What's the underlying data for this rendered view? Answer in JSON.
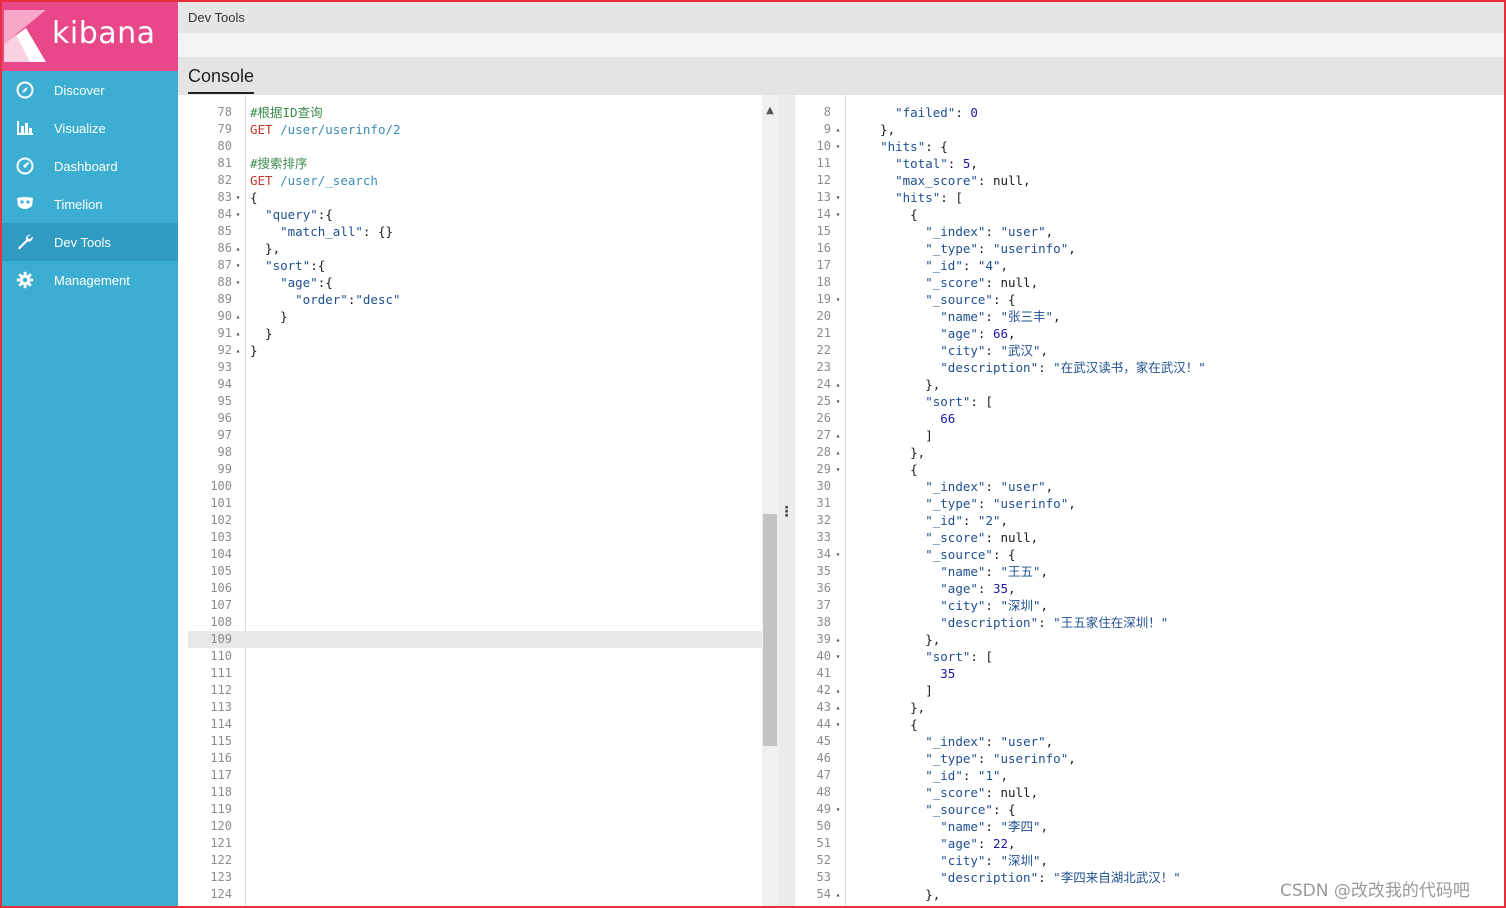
{
  "brand": {
    "name": "kibana",
    "logo_color": "#e8488a",
    "sidebar_color": "#3caed2"
  },
  "nav": [
    {
      "label": "Discover",
      "icon": "compass-icon"
    },
    {
      "label": "Visualize",
      "icon": "bar-chart-icon"
    },
    {
      "label": "Dashboard",
      "icon": "gauge-icon"
    },
    {
      "label": "Timelion",
      "icon": "mask-icon"
    },
    {
      "label": "Dev Tools",
      "icon": "wrench-icon",
      "active": true
    },
    {
      "label": "Management",
      "icon": "gear-icon"
    }
  ],
  "header": {
    "title": "Dev Tools"
  },
  "tabs": {
    "console": "Console"
  },
  "request_lines": [
    {
      "n": "78",
      "fold": "",
      "parts": [
        [
          "c-comment",
          "#根据ID查询"
        ]
      ]
    },
    {
      "n": "79",
      "fold": "",
      "parts": [
        [
          "c-method",
          "GET"
        ],
        [
          "c-plain",
          " "
        ],
        [
          "c-url",
          "/user/userinfo/2"
        ]
      ]
    },
    {
      "n": "80",
      "fold": "",
      "parts": []
    },
    {
      "n": "81",
      "fold": "",
      "parts": [
        [
          "c-comment",
          "#搜索排序"
        ]
      ]
    },
    {
      "n": "82",
      "fold": "",
      "parts": [
        [
          "c-method",
          "GET"
        ],
        [
          "c-plain",
          " "
        ],
        [
          "c-url",
          "/user/_search"
        ]
      ]
    },
    {
      "n": "83",
      "fold": "▾",
      "parts": [
        [
          "c-plain",
          "{"
        ]
      ]
    },
    {
      "n": "84",
      "fold": "▾",
      "parts": [
        [
          "c-plain",
          "  "
        ],
        [
          "c-key",
          "\"query\""
        ],
        [
          "c-plain",
          ":{"
        ]
      ]
    },
    {
      "n": "85",
      "fold": "",
      "parts": [
        [
          "c-plain",
          "    "
        ],
        [
          "c-key",
          "\"match_all\""
        ],
        [
          "c-plain",
          ": {}"
        ]
      ]
    },
    {
      "n": "86",
      "fold": "▴",
      "parts": [
        [
          "c-plain",
          "  },"
        ]
      ]
    },
    {
      "n": "87",
      "fold": "▾",
      "parts": [
        [
          "c-plain",
          "  "
        ],
        [
          "c-key",
          "\"sort\""
        ],
        [
          "c-plain",
          ":{"
        ]
      ]
    },
    {
      "n": "88",
      "fold": "▾",
      "parts": [
        [
          "c-plain",
          "    "
        ],
        [
          "c-key",
          "\"age\""
        ],
        [
          "c-plain",
          ":{"
        ]
      ]
    },
    {
      "n": "89",
      "fold": "",
      "parts": [
        [
          "c-plain",
          "      "
        ],
        [
          "c-key",
          "\"order\""
        ],
        [
          "c-plain",
          ":"
        ],
        [
          "c-str",
          "\"desc\""
        ]
      ]
    },
    {
      "n": "90",
      "fold": "▴",
      "parts": [
        [
          "c-plain",
          "    }"
        ]
      ]
    },
    {
      "n": "91",
      "fold": "▴",
      "parts": [
        [
          "c-plain",
          "  }"
        ]
      ]
    },
    {
      "n": "92",
      "fold": "▴",
      "parts": [
        [
          "c-plain",
          "}"
        ]
      ]
    },
    {
      "n": "93",
      "fold": "",
      "parts": []
    },
    {
      "n": "94",
      "fold": "",
      "parts": []
    },
    {
      "n": "95",
      "fold": "",
      "parts": []
    },
    {
      "n": "96",
      "fold": "",
      "parts": []
    },
    {
      "n": "97",
      "fold": "",
      "parts": []
    },
    {
      "n": "98",
      "fold": "",
      "parts": []
    },
    {
      "n": "99",
      "fold": "",
      "parts": []
    },
    {
      "n": "100",
      "fold": "",
      "parts": []
    },
    {
      "n": "101",
      "fold": "",
      "parts": []
    },
    {
      "n": "102",
      "fold": "",
      "parts": []
    },
    {
      "n": "103",
      "fold": "",
      "parts": []
    },
    {
      "n": "104",
      "fold": "",
      "parts": []
    },
    {
      "n": "105",
      "fold": "",
      "parts": []
    },
    {
      "n": "106",
      "fold": "",
      "parts": []
    },
    {
      "n": "107",
      "fold": "",
      "parts": []
    },
    {
      "n": "108",
      "fold": "",
      "parts": []
    },
    {
      "n": "109",
      "fold": "",
      "parts": [],
      "active": true
    },
    {
      "n": "110",
      "fold": "",
      "parts": []
    },
    {
      "n": "111",
      "fold": "",
      "parts": []
    },
    {
      "n": "112",
      "fold": "",
      "parts": []
    },
    {
      "n": "113",
      "fold": "",
      "parts": []
    },
    {
      "n": "114",
      "fold": "",
      "parts": []
    },
    {
      "n": "115",
      "fold": "",
      "parts": []
    },
    {
      "n": "116",
      "fold": "",
      "parts": []
    },
    {
      "n": "117",
      "fold": "",
      "parts": []
    },
    {
      "n": "118",
      "fold": "",
      "parts": []
    },
    {
      "n": "119",
      "fold": "",
      "parts": []
    },
    {
      "n": "120",
      "fold": "",
      "parts": []
    },
    {
      "n": "121",
      "fold": "",
      "parts": []
    },
    {
      "n": "122",
      "fold": "",
      "parts": []
    },
    {
      "n": "123",
      "fold": "",
      "parts": []
    },
    {
      "n": "124",
      "fold": "",
      "parts": []
    }
  ],
  "response_lines": [
    {
      "n": "8",
      "fold": "",
      "parts": [
        [
          "c-plain",
          "    "
        ],
        [
          "c-key",
          "\"failed\""
        ],
        [
          "c-plain",
          ": "
        ],
        [
          "c-num",
          "0"
        ]
      ]
    },
    {
      "n": "9",
      "fold": "▴",
      "parts": [
        [
          "c-plain",
          "  },"
        ]
      ]
    },
    {
      "n": "10",
      "fold": "▾",
      "parts": [
        [
          "c-plain",
          "  "
        ],
        [
          "c-key",
          "\"hits\""
        ],
        [
          "c-plain",
          ": {"
        ]
      ]
    },
    {
      "n": "11",
      "fold": "",
      "parts": [
        [
          "c-plain",
          "    "
        ],
        [
          "c-key",
          "\"total\""
        ],
        [
          "c-plain",
          ": "
        ],
        [
          "c-num",
          "5"
        ],
        [
          "c-plain",
          ","
        ]
      ]
    },
    {
      "n": "12",
      "fold": "",
      "parts": [
        [
          "c-plain",
          "    "
        ],
        [
          "c-key",
          "\"max_score\""
        ],
        [
          "c-plain",
          ": null,"
        ]
      ]
    },
    {
      "n": "13",
      "fold": "▾",
      "parts": [
        [
          "c-plain",
          "    "
        ],
        [
          "c-key",
          "\"hits\""
        ],
        [
          "c-plain",
          ": ["
        ]
      ]
    },
    {
      "n": "14",
      "fold": "▾",
      "parts": [
        [
          "c-plain",
          "      {"
        ]
      ]
    },
    {
      "n": "15",
      "fold": "",
      "parts": [
        [
          "c-plain",
          "        "
        ],
        [
          "c-key",
          "\"_index\""
        ],
        [
          "c-plain",
          ": "
        ],
        [
          "c-str",
          "\"user\""
        ],
        [
          "c-plain",
          ","
        ]
      ]
    },
    {
      "n": "16",
      "fold": "",
      "parts": [
        [
          "c-plain",
          "        "
        ],
        [
          "c-key",
          "\"_type\""
        ],
        [
          "c-plain",
          ": "
        ],
        [
          "c-str",
          "\"userinfo\""
        ],
        [
          "c-plain",
          ","
        ]
      ]
    },
    {
      "n": "17",
      "fold": "",
      "parts": [
        [
          "c-plain",
          "        "
        ],
        [
          "c-key",
          "\"_id\""
        ],
        [
          "c-plain",
          ": "
        ],
        [
          "c-str",
          "\"4\""
        ],
        [
          "c-plain",
          ","
        ]
      ]
    },
    {
      "n": "18",
      "fold": "",
      "parts": [
        [
          "c-plain",
          "        "
        ],
        [
          "c-key",
          "\"_score\""
        ],
        [
          "c-plain",
          ": null,"
        ]
      ]
    },
    {
      "n": "19",
      "fold": "▾",
      "parts": [
        [
          "c-plain",
          "        "
        ],
        [
          "c-key",
          "\"_source\""
        ],
        [
          "c-plain",
          ": {"
        ]
      ]
    },
    {
      "n": "20",
      "fold": "",
      "parts": [
        [
          "c-plain",
          "          "
        ],
        [
          "c-key",
          "\"name\""
        ],
        [
          "c-plain",
          ": "
        ],
        [
          "c-str",
          "\"张三丰\""
        ],
        [
          "c-plain",
          ","
        ]
      ]
    },
    {
      "n": "21",
      "fold": "",
      "parts": [
        [
          "c-plain",
          "          "
        ],
        [
          "c-key",
          "\"age\""
        ],
        [
          "c-plain",
          ": "
        ],
        [
          "c-num",
          "66"
        ],
        [
          "c-plain",
          ","
        ]
      ]
    },
    {
      "n": "22",
      "fold": "",
      "parts": [
        [
          "c-plain",
          "          "
        ],
        [
          "c-key",
          "\"city\""
        ],
        [
          "c-plain",
          ": "
        ],
        [
          "c-str",
          "\"武汉\""
        ],
        [
          "c-plain",
          ","
        ]
      ]
    },
    {
      "n": "23",
      "fold": "",
      "parts": [
        [
          "c-plain",
          "          "
        ],
        [
          "c-key",
          "\"description\""
        ],
        [
          "c-plain",
          ": "
        ],
        [
          "c-str",
          "\"在武汉读书，家在武汉！\""
        ]
      ]
    },
    {
      "n": "24",
      "fold": "▴",
      "parts": [
        [
          "c-plain",
          "        },"
        ]
      ]
    },
    {
      "n": "25",
      "fold": "▾",
      "parts": [
        [
          "c-plain",
          "        "
        ],
        [
          "c-key",
          "\"sort\""
        ],
        [
          "c-plain",
          ": ["
        ]
      ]
    },
    {
      "n": "26",
      "fold": "",
      "parts": [
        [
          "c-plain",
          "          "
        ],
        [
          "c-num",
          "66"
        ]
      ]
    },
    {
      "n": "27",
      "fold": "▴",
      "parts": [
        [
          "c-plain",
          "        ]"
        ]
      ]
    },
    {
      "n": "28",
      "fold": "▴",
      "parts": [
        [
          "c-plain",
          "      },"
        ]
      ]
    },
    {
      "n": "29",
      "fold": "▾",
      "parts": [
        [
          "c-plain",
          "      {"
        ]
      ]
    },
    {
      "n": "30",
      "fold": "",
      "parts": [
        [
          "c-plain",
          "        "
        ],
        [
          "c-key",
          "\"_index\""
        ],
        [
          "c-plain",
          ": "
        ],
        [
          "c-str",
          "\"user\""
        ],
        [
          "c-plain",
          ","
        ]
      ]
    },
    {
      "n": "31",
      "fold": "",
      "parts": [
        [
          "c-plain",
          "        "
        ],
        [
          "c-key",
          "\"_type\""
        ],
        [
          "c-plain",
          ": "
        ],
        [
          "c-str",
          "\"userinfo\""
        ],
        [
          "c-plain",
          ","
        ]
      ]
    },
    {
      "n": "32",
      "fold": "",
      "parts": [
        [
          "c-plain",
          "        "
        ],
        [
          "c-key",
          "\"_id\""
        ],
        [
          "c-plain",
          ": "
        ],
        [
          "c-str",
          "\"2\""
        ],
        [
          "c-plain",
          ","
        ]
      ]
    },
    {
      "n": "33",
      "fold": "",
      "parts": [
        [
          "c-plain",
          "        "
        ],
        [
          "c-key",
          "\"_score\""
        ],
        [
          "c-plain",
          ": null,"
        ]
      ]
    },
    {
      "n": "34",
      "fold": "▾",
      "parts": [
        [
          "c-plain",
          "        "
        ],
        [
          "c-key",
          "\"_source\""
        ],
        [
          "c-plain",
          ": {"
        ]
      ]
    },
    {
      "n": "35",
      "fold": "",
      "parts": [
        [
          "c-plain",
          "          "
        ],
        [
          "c-key",
          "\"name\""
        ],
        [
          "c-plain",
          ": "
        ],
        [
          "c-str",
          "\"王五\""
        ],
        [
          "c-plain",
          ","
        ]
      ]
    },
    {
      "n": "36",
      "fold": "",
      "parts": [
        [
          "c-plain",
          "          "
        ],
        [
          "c-key",
          "\"age\""
        ],
        [
          "c-plain",
          ": "
        ],
        [
          "c-num",
          "35"
        ],
        [
          "c-plain",
          ","
        ]
      ]
    },
    {
      "n": "37",
      "fold": "",
      "parts": [
        [
          "c-plain",
          "          "
        ],
        [
          "c-key",
          "\"city\""
        ],
        [
          "c-plain",
          ": "
        ],
        [
          "c-str",
          "\"深圳\""
        ],
        [
          "c-plain",
          ","
        ]
      ]
    },
    {
      "n": "38",
      "fold": "",
      "parts": [
        [
          "c-plain",
          "          "
        ],
        [
          "c-key",
          "\"description\""
        ],
        [
          "c-plain",
          ": "
        ],
        [
          "c-str",
          "\"王五家住在深圳！\""
        ]
      ]
    },
    {
      "n": "39",
      "fold": "▴",
      "parts": [
        [
          "c-plain",
          "        },"
        ]
      ]
    },
    {
      "n": "40",
      "fold": "▾",
      "parts": [
        [
          "c-plain",
          "        "
        ],
        [
          "c-key",
          "\"sort\""
        ],
        [
          "c-plain",
          ": ["
        ]
      ]
    },
    {
      "n": "41",
      "fold": "",
      "parts": [
        [
          "c-plain",
          "          "
        ],
        [
          "c-num",
          "35"
        ]
      ]
    },
    {
      "n": "42",
      "fold": "▴",
      "parts": [
        [
          "c-plain",
          "        ]"
        ]
      ]
    },
    {
      "n": "43",
      "fold": "▴",
      "parts": [
        [
          "c-plain",
          "      },"
        ]
      ]
    },
    {
      "n": "44",
      "fold": "▾",
      "parts": [
        [
          "c-plain",
          "      {"
        ]
      ]
    },
    {
      "n": "45",
      "fold": "",
      "parts": [
        [
          "c-plain",
          "        "
        ],
        [
          "c-key",
          "\"_index\""
        ],
        [
          "c-plain",
          ": "
        ],
        [
          "c-str",
          "\"user\""
        ],
        [
          "c-plain",
          ","
        ]
      ]
    },
    {
      "n": "46",
      "fold": "",
      "parts": [
        [
          "c-plain",
          "        "
        ],
        [
          "c-key",
          "\"_type\""
        ],
        [
          "c-plain",
          ": "
        ],
        [
          "c-str",
          "\"userinfo\""
        ],
        [
          "c-plain",
          ","
        ]
      ]
    },
    {
      "n": "47",
      "fold": "",
      "parts": [
        [
          "c-plain",
          "        "
        ],
        [
          "c-key",
          "\"_id\""
        ],
        [
          "c-plain",
          ": "
        ],
        [
          "c-str",
          "\"1\""
        ],
        [
          "c-plain",
          ","
        ]
      ]
    },
    {
      "n": "48",
      "fold": "",
      "parts": [
        [
          "c-plain",
          "        "
        ],
        [
          "c-key",
          "\"_score\""
        ],
        [
          "c-plain",
          ": null,"
        ]
      ]
    },
    {
      "n": "49",
      "fold": "▾",
      "parts": [
        [
          "c-plain",
          "        "
        ],
        [
          "c-key",
          "\"_source\""
        ],
        [
          "c-plain",
          ": {"
        ]
      ]
    },
    {
      "n": "50",
      "fold": "",
      "parts": [
        [
          "c-plain",
          "          "
        ],
        [
          "c-key",
          "\"name\""
        ],
        [
          "c-plain",
          ": "
        ],
        [
          "c-str",
          "\"李四\""
        ],
        [
          "c-plain",
          ","
        ]
      ]
    },
    {
      "n": "51",
      "fold": "",
      "parts": [
        [
          "c-plain",
          "          "
        ],
        [
          "c-key",
          "\"age\""
        ],
        [
          "c-plain",
          ": "
        ],
        [
          "c-num",
          "22"
        ],
        [
          "c-plain",
          ","
        ]
      ]
    },
    {
      "n": "52",
      "fold": "",
      "parts": [
        [
          "c-plain",
          "          "
        ],
        [
          "c-key",
          "\"city\""
        ],
        [
          "c-plain",
          ": "
        ],
        [
          "c-str",
          "\"深圳\""
        ],
        [
          "c-plain",
          ","
        ]
      ]
    },
    {
      "n": "53",
      "fold": "",
      "parts": [
        [
          "c-plain",
          "          "
        ],
        [
          "c-key",
          "\"description\""
        ],
        [
          "c-plain",
          ": "
        ],
        [
          "c-str",
          "\"李四来自湖北武汉！\""
        ]
      ]
    },
    {
      "n": "54",
      "fold": "▴",
      "parts": [
        [
          "c-plain",
          "        },"
        ]
      ]
    }
  ],
  "watermark": "CSDN @改改我的代码吧"
}
